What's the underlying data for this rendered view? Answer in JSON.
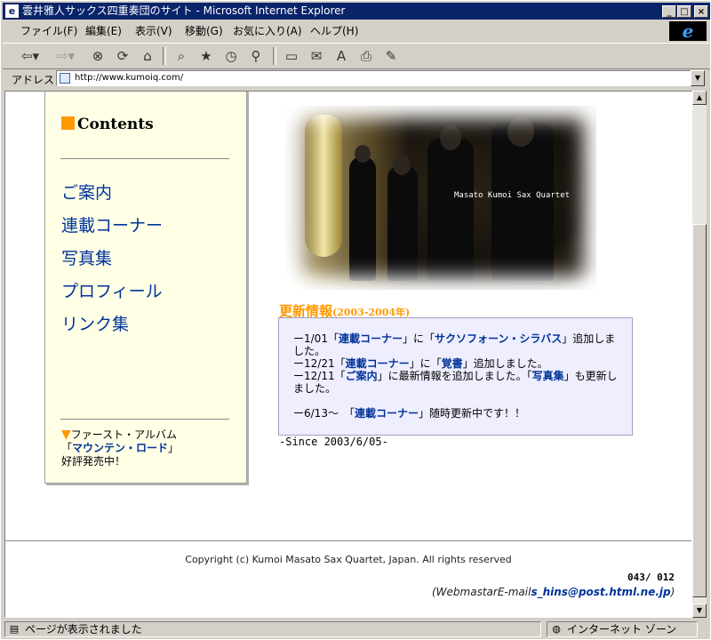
{
  "window": {
    "title": "雲井雅人サックス四重奏団のサイト - Microsoft Internet Explorer",
    "controls": {
      "minimize": "_",
      "maximize": "□",
      "close": "×"
    }
  },
  "menu": {
    "items": [
      "ファイル(F)",
      "編集(E)",
      "表示(V)",
      "移動(G)",
      "お気に入り(A)",
      "ヘルプ(H)"
    ]
  },
  "toolbar": {
    "icons": [
      "back-icon",
      "forward-icon",
      "stop-icon",
      "refresh-icon",
      "home-icon",
      "search-icon",
      "favorites-icon",
      "history-icon",
      "channels-icon",
      "fullscreen-icon",
      "mail-icon",
      "font-icon",
      "print-icon",
      "edit-icon"
    ]
  },
  "address": {
    "label": "アドレス",
    "url": "http://www.kumoiq.com/"
  },
  "sidebar": {
    "heading": "Contents",
    "nav": [
      "ご案内",
      "連載コーナー",
      "写真集",
      "プロフィール",
      "リンク集"
    ],
    "promo": {
      "line1": "ファースト・アルバム",
      "album_prefix": "「",
      "album": "マウンテン・ロード",
      "album_suffix": "」",
      "line3": "好評発売中！"
    }
  },
  "hero": {
    "caption": "Masato Kumoi Sax Quartet"
  },
  "updates": {
    "heading": "更新情報",
    "period": "(2003-2004年)",
    "entries": [
      {
        "pre": "ー1/01「",
        "link1": "連載コーナー",
        "mid": "」に「",
        "link2": "サクソフォーン・シラバス",
        "post": "」追加しました。"
      },
      {
        "pre": "ー12/21「",
        "link1": "連載コーナー",
        "mid": "」に「",
        "link2": "覚書",
        "post": "」追加しました。"
      },
      {
        "pre": "ー12/11「",
        "link1": "ご案内",
        "mid": "」に最新情報を追加しました。「",
        "link2": "写真集",
        "post": "」も更新しました。"
      }
    ],
    "ongoing": {
      "pre": "ー6/13～　「",
      "link": "連載コーナー",
      "post": "」随時更新中です！！"
    },
    "since": "-Since 2003/6/05-"
  },
  "footer": {
    "copyright": "Copyright (c) Kumoi Masato Sax Quartet, Japan. All rights reserved",
    "counter": "043/ 012",
    "mail_label": "(WebmastarE-mail",
    "mail_address": "s_hins@post.html.ne.jp",
    "mail_end": ")"
  },
  "status": {
    "message": "ページが表示されました",
    "zone": "インターネット ゾーン"
  },
  "colors": {
    "accent_orange": "#ff9900",
    "link_blue": "#003399",
    "sidebar_bg": "#ffffe6",
    "newsbox_bg": "#eeeeff",
    "titlebar": "#0a246a"
  }
}
